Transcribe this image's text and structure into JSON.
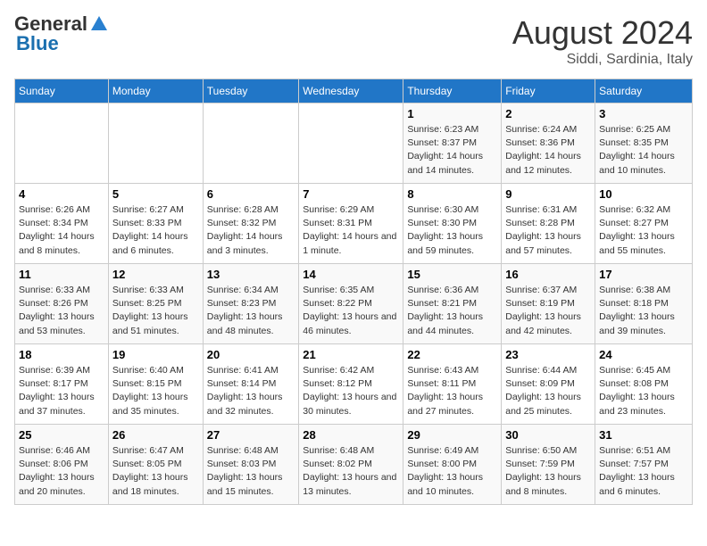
{
  "header": {
    "logo_general": "General",
    "logo_blue": "Blue",
    "month_year": "August 2024",
    "location": "Siddi, Sardinia, Italy"
  },
  "days_of_week": [
    "Sunday",
    "Monday",
    "Tuesday",
    "Wednesday",
    "Thursday",
    "Friday",
    "Saturday"
  ],
  "weeks": [
    [
      {
        "day": "",
        "info": ""
      },
      {
        "day": "",
        "info": ""
      },
      {
        "day": "",
        "info": ""
      },
      {
        "day": "",
        "info": ""
      },
      {
        "day": "1",
        "info": "Sunrise: 6:23 AM\nSunset: 8:37 PM\nDaylight: 14 hours and 14 minutes."
      },
      {
        "day": "2",
        "info": "Sunrise: 6:24 AM\nSunset: 8:36 PM\nDaylight: 14 hours and 12 minutes."
      },
      {
        "day": "3",
        "info": "Sunrise: 6:25 AM\nSunset: 8:35 PM\nDaylight: 14 hours and 10 minutes."
      }
    ],
    [
      {
        "day": "4",
        "info": "Sunrise: 6:26 AM\nSunset: 8:34 PM\nDaylight: 14 hours and 8 minutes."
      },
      {
        "day": "5",
        "info": "Sunrise: 6:27 AM\nSunset: 8:33 PM\nDaylight: 14 hours and 6 minutes."
      },
      {
        "day": "6",
        "info": "Sunrise: 6:28 AM\nSunset: 8:32 PM\nDaylight: 14 hours and 3 minutes."
      },
      {
        "day": "7",
        "info": "Sunrise: 6:29 AM\nSunset: 8:31 PM\nDaylight: 14 hours and 1 minute."
      },
      {
        "day": "8",
        "info": "Sunrise: 6:30 AM\nSunset: 8:30 PM\nDaylight: 13 hours and 59 minutes."
      },
      {
        "day": "9",
        "info": "Sunrise: 6:31 AM\nSunset: 8:28 PM\nDaylight: 13 hours and 57 minutes."
      },
      {
        "day": "10",
        "info": "Sunrise: 6:32 AM\nSunset: 8:27 PM\nDaylight: 13 hours and 55 minutes."
      }
    ],
    [
      {
        "day": "11",
        "info": "Sunrise: 6:33 AM\nSunset: 8:26 PM\nDaylight: 13 hours and 53 minutes."
      },
      {
        "day": "12",
        "info": "Sunrise: 6:33 AM\nSunset: 8:25 PM\nDaylight: 13 hours and 51 minutes."
      },
      {
        "day": "13",
        "info": "Sunrise: 6:34 AM\nSunset: 8:23 PM\nDaylight: 13 hours and 48 minutes."
      },
      {
        "day": "14",
        "info": "Sunrise: 6:35 AM\nSunset: 8:22 PM\nDaylight: 13 hours and 46 minutes."
      },
      {
        "day": "15",
        "info": "Sunrise: 6:36 AM\nSunset: 8:21 PM\nDaylight: 13 hours and 44 minutes."
      },
      {
        "day": "16",
        "info": "Sunrise: 6:37 AM\nSunset: 8:19 PM\nDaylight: 13 hours and 42 minutes."
      },
      {
        "day": "17",
        "info": "Sunrise: 6:38 AM\nSunset: 8:18 PM\nDaylight: 13 hours and 39 minutes."
      }
    ],
    [
      {
        "day": "18",
        "info": "Sunrise: 6:39 AM\nSunset: 8:17 PM\nDaylight: 13 hours and 37 minutes."
      },
      {
        "day": "19",
        "info": "Sunrise: 6:40 AM\nSunset: 8:15 PM\nDaylight: 13 hours and 35 minutes."
      },
      {
        "day": "20",
        "info": "Sunrise: 6:41 AM\nSunset: 8:14 PM\nDaylight: 13 hours and 32 minutes."
      },
      {
        "day": "21",
        "info": "Sunrise: 6:42 AM\nSunset: 8:12 PM\nDaylight: 13 hours and 30 minutes."
      },
      {
        "day": "22",
        "info": "Sunrise: 6:43 AM\nSunset: 8:11 PM\nDaylight: 13 hours and 27 minutes."
      },
      {
        "day": "23",
        "info": "Sunrise: 6:44 AM\nSunset: 8:09 PM\nDaylight: 13 hours and 25 minutes."
      },
      {
        "day": "24",
        "info": "Sunrise: 6:45 AM\nSunset: 8:08 PM\nDaylight: 13 hours and 23 minutes."
      }
    ],
    [
      {
        "day": "25",
        "info": "Sunrise: 6:46 AM\nSunset: 8:06 PM\nDaylight: 13 hours and 20 minutes."
      },
      {
        "day": "26",
        "info": "Sunrise: 6:47 AM\nSunset: 8:05 PM\nDaylight: 13 hours and 18 minutes."
      },
      {
        "day": "27",
        "info": "Sunrise: 6:48 AM\nSunset: 8:03 PM\nDaylight: 13 hours and 15 minutes."
      },
      {
        "day": "28",
        "info": "Sunrise: 6:48 AM\nSunset: 8:02 PM\nDaylight: 13 hours and 13 minutes."
      },
      {
        "day": "29",
        "info": "Sunrise: 6:49 AM\nSunset: 8:00 PM\nDaylight: 13 hours and 10 minutes."
      },
      {
        "day": "30",
        "info": "Sunrise: 6:50 AM\nSunset: 7:59 PM\nDaylight: 13 hours and 8 minutes."
      },
      {
        "day": "31",
        "info": "Sunrise: 6:51 AM\nSunset: 7:57 PM\nDaylight: 13 hours and 6 minutes."
      }
    ]
  ]
}
